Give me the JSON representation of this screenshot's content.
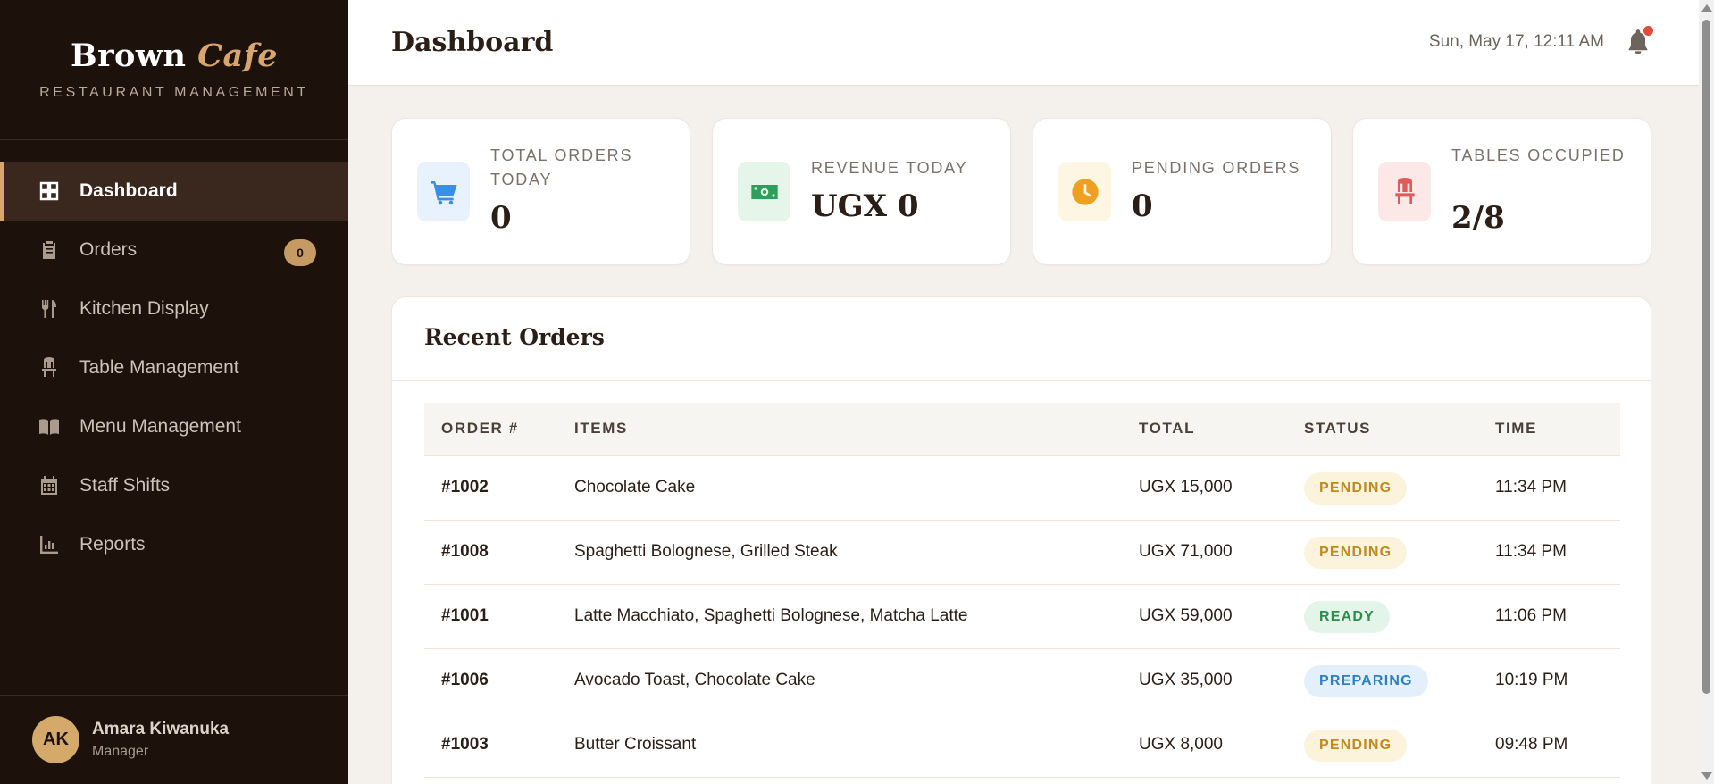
{
  "brand": {
    "name": "Brown",
    "name_accent": "Cafe",
    "subtitle": "RESTAURANT MANAGEMENT"
  },
  "sidebar": {
    "items": [
      {
        "label": "Dashboard",
        "icon": "dashboard-icon",
        "active": true
      },
      {
        "label": "Orders",
        "icon": "clipboard-icon",
        "badge": "0"
      },
      {
        "label": "Kitchen Display",
        "icon": "utensils-icon"
      },
      {
        "label": "Table Management",
        "icon": "chair-icon"
      },
      {
        "label": "Menu Management",
        "icon": "book-icon"
      },
      {
        "label": "Staff Shifts",
        "icon": "calendar-icon"
      },
      {
        "label": "Reports",
        "icon": "chart-icon"
      }
    ]
  },
  "user": {
    "initials": "AK",
    "name": "Amara Kiwanuka",
    "role": "Manager"
  },
  "header": {
    "title": "Dashboard",
    "datetime": "Sun, May 17, 12:11 AM",
    "notification_icon": "bell-icon"
  },
  "stats": [
    {
      "label": "TOTAL ORDERS TODAY",
      "value": "0",
      "icon": "cart-icon",
      "color": "#3b8fe0",
      "bg": "#e8f2fc"
    },
    {
      "label": "REVENUE TODAY",
      "value": "UGX 0",
      "icon": "money-icon",
      "color": "#2e9e5b",
      "bg": "#e5f5ea"
    },
    {
      "label": "PENDING ORDERS",
      "value": "0",
      "icon": "clock-icon",
      "color": "#f0a020",
      "bg": "#fdf6e3"
    },
    {
      "label": "TABLES OCCUPIED",
      "value": "2/8",
      "icon": "chair-icon",
      "color": "#e05a5a",
      "bg": "#fde8e8"
    }
  ],
  "recent_orders": {
    "title": "Recent Orders",
    "columns": [
      "ORDER #",
      "ITEMS",
      "TOTAL",
      "STATUS",
      "TIME"
    ],
    "rows": [
      {
        "order": "#1002",
        "items": "Chocolate Cake",
        "total": "UGX 15,000",
        "status": "PENDING",
        "time": "11:34 PM"
      },
      {
        "order": "#1008",
        "items": "Spaghetti Bolognese, Grilled Steak",
        "total": "UGX 71,000",
        "status": "PENDING",
        "time": "11:34 PM"
      },
      {
        "order": "#1001",
        "items": "Latte Macchiato, Spaghetti Bolognese, Matcha Latte",
        "total": "UGX 59,000",
        "status": "READY",
        "time": "11:06 PM"
      },
      {
        "order": "#1006",
        "items": "Avocado Toast, Chocolate Cake",
        "total": "UGX 35,000",
        "status": "PREPARING",
        "time": "10:19 PM"
      },
      {
        "order": "#1003",
        "items": "Butter Croissant",
        "total": "UGX 8,000",
        "status": "PENDING",
        "time": "09:48 PM"
      }
    ]
  },
  "status_colors": {
    "PENDING": {
      "fg": "#c08a1e",
      "bg": "#fbf3dc"
    },
    "READY": {
      "fg": "#2e8a4f",
      "bg": "#e3f4e8"
    },
    "PREPARING": {
      "fg": "#2f7fc0",
      "bg": "#e3f0fb"
    }
  }
}
